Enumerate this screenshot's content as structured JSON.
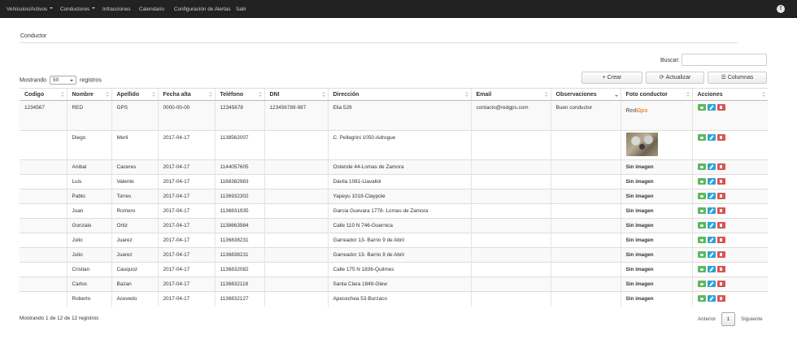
{
  "nav": {
    "items": [
      {
        "label": "Vehículos/Activos",
        "dropdown": true
      },
      {
        "label": "Conductores",
        "dropdown": true
      },
      {
        "label": "Infracciones",
        "dropdown": false
      },
      {
        "label": "Calendario",
        "dropdown": false
      },
      {
        "label": "Configuración de Alertas",
        "dropdown": false
      },
      {
        "label": "Salir",
        "dropdown": false
      }
    ],
    "info_glyph": "!"
  },
  "page": {
    "title": "Conductor"
  },
  "search": {
    "label": "Buscar:",
    "value": ""
  },
  "length": {
    "prefix": "Mostrando",
    "value": "50",
    "suffix": "registros"
  },
  "toolbar": {
    "create_label": "Crear",
    "refresh_label": "Actualizar",
    "columns_label": "Columnas",
    "create_icon": "+",
    "refresh_icon": "⟳",
    "columns_icon": "☰"
  },
  "table": {
    "headers": [
      "Codigo",
      "Nombre",
      "Apellido",
      "Fecha alta",
      "Teléfono",
      "DNI",
      "Dirección",
      "Email",
      "Observaciones",
      "Foto conductor",
      "Acciones"
    ],
    "rows": [
      {
        "codigo": "1234567",
        "nombre": "RED",
        "apellido": "GPS",
        "fecha": "0000-00-00",
        "telefono": "12345678",
        "dni": "123456789-987",
        "direccion": "Elia 529",
        "email": "contacto@redgps.com",
        "obs": "Buen conductor",
        "photo": "logo",
        "photo_text": "",
        "logo_a": "Red",
        "logo_b": "Gps"
      },
      {
        "codigo": "",
        "nombre": "Diego",
        "apellido": "Merli",
        "fecha": "2017-04-17",
        "telefono": "1138562007",
        "dni": "",
        "direccion": "C. Pellegrini 1050-Adrogue",
        "email": "",
        "obs": "",
        "photo": "koala",
        "photo_text": ""
      },
      {
        "codigo": "",
        "nombre": "Anibal",
        "apellido": "Caceres",
        "fecha": "2017-04-17",
        "telefono": "1144057605",
        "dni": "",
        "direccion": "Ostende 44-Lomas de Zamora",
        "email": "",
        "obs": "",
        "photo": "none",
        "photo_text": "Sin imagen"
      },
      {
        "codigo": "",
        "nombre": "Luis",
        "apellido": "Valente",
        "fecha": "2017-04-17",
        "telefono": "1168382983",
        "dni": "",
        "direccion": "Dávila 1081-Llavallol",
        "email": "",
        "obs": "",
        "photo": "none",
        "photo_text": "Sin imagen"
      },
      {
        "codigo": "",
        "nombre": "Pablo",
        "apellido": "Torres",
        "fecha": "2017-04-17",
        "telefono": "1136932302",
        "dni": "",
        "direccion": "Yapeyu 1018-Claypole",
        "email": "",
        "obs": "",
        "photo": "none",
        "photo_text": "Sin imagen"
      },
      {
        "codigo": "",
        "nombre": "Juan",
        "apellido": "Romero",
        "fecha": "2017-04-17",
        "telefono": "1136831935",
        "dni": "",
        "direccion": "Garcia Guevara 1778- Lomas de Zamora",
        "email": "",
        "obs": "",
        "photo": "none",
        "photo_text": "Sin imagen"
      },
      {
        "codigo": "",
        "nombre": "Gonzalo",
        "apellido": "Ortiz",
        "fecha": "2017-04-17",
        "telefono": "1138663984",
        "dni": "",
        "direccion": "Calle 110 N 746-Guernica",
        "email": "",
        "obs": "",
        "photo": "none",
        "photo_text": "Sin imagen"
      },
      {
        "codigo": "",
        "nombre": "Julio",
        "apellido": "Juarez",
        "fecha": "2017-04-17",
        "telefono": "1136838231",
        "dni": "",
        "direccion": "Garreador 13- Barrio 9 de Abril",
        "email": "",
        "obs": "",
        "photo": "none",
        "photo_text": "Sin imagen"
      },
      {
        "codigo": "",
        "nombre": "Julio",
        "apellido": "Juarez",
        "fecha": "2017-04-17",
        "telefono": "1136838231",
        "dni": "",
        "direccion": "Garreador 13- Barrio 9 de Abril",
        "email": "",
        "obs": "",
        "photo": "none",
        "photo_text": "Sin imagen"
      },
      {
        "codigo": "",
        "nombre": "Cristian",
        "apellido": "Cauquoz",
        "fecha": "2017-04-17",
        "telefono": "1136832082",
        "dni": "",
        "direccion": "Calle 175 N 1836-Quilmes",
        "email": "",
        "obs": "",
        "photo": "none",
        "photo_text": "Sin imagen"
      },
      {
        "codigo": "",
        "nombre": "Carlos",
        "apellido": "Bazan",
        "fecha": "2017-04-17",
        "telefono": "1136832118",
        "dni": "",
        "direccion": "Santa Clara 1849-Glew",
        "email": "",
        "obs": "",
        "photo": "none",
        "photo_text": "Sin imagen"
      },
      {
        "codigo": "",
        "nombre": "Roberto",
        "apellido": "Acevedo",
        "fecha": "2017-04-17",
        "telefono": "1136832127",
        "dni": "",
        "direccion": "Apecechea 53-Burzaco",
        "email": "",
        "obs": "",
        "photo": "none",
        "photo_text": "Sin imagen"
      }
    ]
  },
  "footer": {
    "info": "Mostrando 1 de 12 de 12 registros",
    "prev_label": "Anterior",
    "page": "1",
    "next_label": "Siguiente"
  },
  "colors": {
    "navbar": "#222222",
    "view": "#5cb85c",
    "edit": "#31a1d2",
    "delete": "#d9534f"
  }
}
